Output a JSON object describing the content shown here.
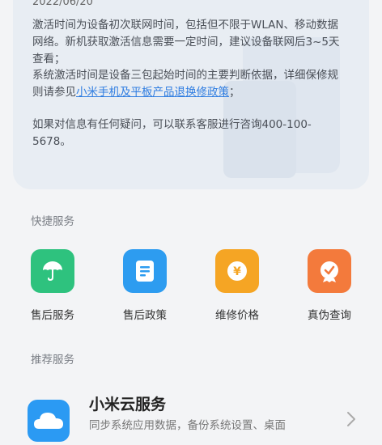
{
  "warranty": {
    "date": "2022/06/20",
    "p1": "激活时间为设备初次联网时间，包括但不限于WLAN、移动数据网络。新机获取激活信息需要一定时间，建议设备联网后3~5天查看；",
    "p2_before": "系统激活时间是设备三包起始时间的主要判断依据，详细保修规则请参见",
    "p2_link": "小米手机及平板产品退换修政策",
    "p2_after": "；",
    "p3": "如果对信息有任何疑问，可以联系客服进行咨询400-100-5678。"
  },
  "quick": {
    "title": "快捷服务",
    "items": [
      {
        "label": "售后服务",
        "icon": "umbrella-icon",
        "color": "#2ec27e"
      },
      {
        "label": "售后政策",
        "icon": "document-icon",
        "color": "#2d9cf0"
      },
      {
        "label": "维修价格",
        "icon": "yen-icon",
        "color": "#f5a524"
      },
      {
        "label": "真伪查询",
        "icon": "verified-badge-icon",
        "color": "#f37a3c"
      }
    ]
  },
  "recommend": {
    "title": "推荐服务",
    "name": "小米云服务",
    "desc": "同步系统应用数据，备份系统设置、桌面",
    "icon": "cloud-icon",
    "color": "#2b9af3"
  }
}
